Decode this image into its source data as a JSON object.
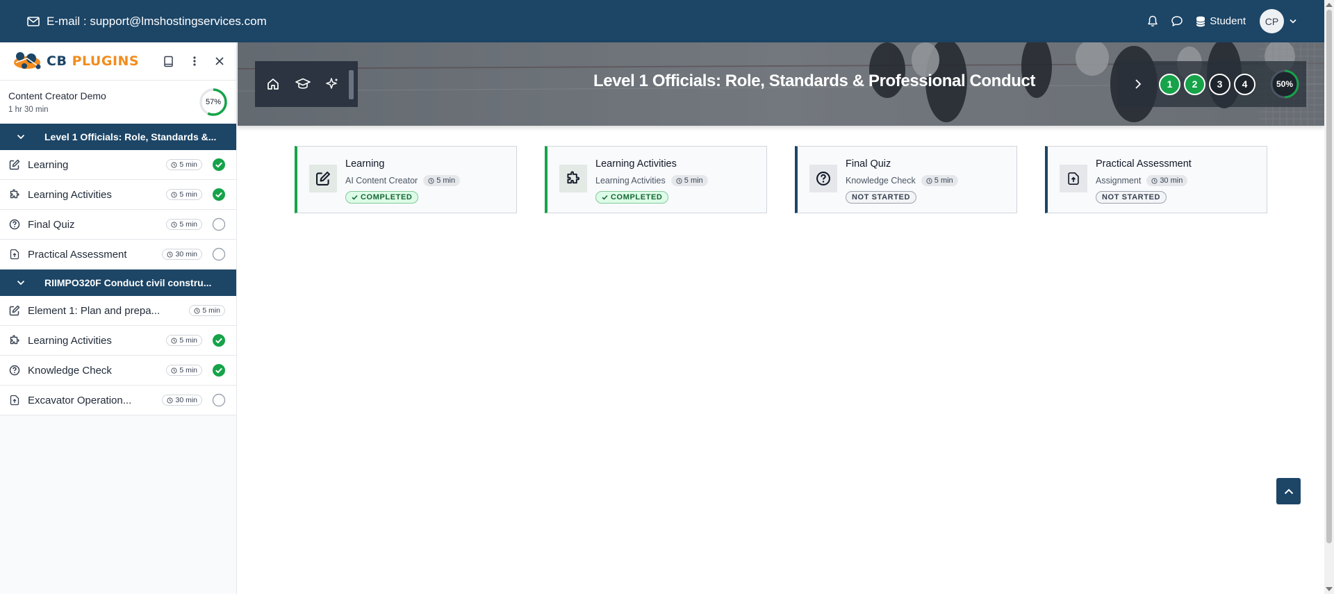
{
  "topbar": {
    "email_text": "E-mail : support@lmshostingservices.com",
    "role": "Student",
    "avatar_initials": "CP"
  },
  "sidebar": {
    "logo_cb": "CB",
    "logo_plugins": "PLUGINS",
    "course_title": "Content Creator Demo",
    "course_duration": "1 hr 30 min",
    "course_progress": "57%",
    "course_progress_value": 57,
    "sections": [
      {
        "title": "Level 1 Officials: Role, Standards &...",
        "items": [
          {
            "label": "Learning",
            "icon": "edit-icon",
            "time": "5 min",
            "status": "complete"
          },
          {
            "label": "Learning Activities",
            "icon": "puzzle-icon",
            "time": "5 min",
            "status": "complete"
          },
          {
            "label": "Final Quiz",
            "icon": "question-circle-icon",
            "time": "5 min",
            "status": "incomplete"
          },
          {
            "label": "Practical Assessment",
            "icon": "file-upload-icon",
            "time": "30 min",
            "status": "incomplete"
          }
        ]
      },
      {
        "title": "RIIMPO320F Conduct civil constru...",
        "items": [
          {
            "label": "Element 1: Plan and prepa...",
            "icon": "edit-icon",
            "time": "5 min",
            "status": "none"
          },
          {
            "label": "Learning Activities",
            "icon": "puzzle-icon",
            "time": "5 min",
            "status": "complete"
          },
          {
            "label": "Knowledge Check",
            "icon": "question-circle-icon",
            "time": "5 min",
            "status": "complete"
          },
          {
            "label": "Excavator Operation...",
            "icon": "file-upload-icon",
            "time": "30 min",
            "status": "incomplete"
          }
        ]
      }
    ]
  },
  "hero": {
    "title": "Level 1 Officials: Role, Standards & Professional Conduct",
    "steps": [
      {
        "label": "1",
        "state": "done"
      },
      {
        "label": "2",
        "state": "done"
      },
      {
        "label": "3",
        "state": "todo"
      },
      {
        "label": "4",
        "state": "todo"
      }
    ],
    "progress": "50%",
    "progress_value": 50
  },
  "cards": [
    {
      "title": "Learning",
      "subtitle": "AI Content Creator",
      "time": "5 min",
      "status": "COMPLETED",
      "state": "ok",
      "icon": "edit-icon"
    },
    {
      "title": "Learning Activities",
      "subtitle": "Learning Activities",
      "time": "5 min",
      "status": "COMPLETED",
      "state": "ok",
      "icon": "puzzle-icon"
    },
    {
      "title": "Final Quiz",
      "subtitle": "Knowledge Check",
      "time": "5 min",
      "status": "NOT STARTED",
      "state": "ns",
      "icon": "question-circle-icon"
    },
    {
      "title": "Practical Assessment",
      "subtitle": "Assignment",
      "time": "30 min",
      "status": "NOT STARTED",
      "state": "ns",
      "icon": "file-upload-icon"
    }
  ],
  "colors": {
    "brand": "#1c4566",
    "accent_orange": "#f28c1e",
    "success": "#16a34a"
  }
}
